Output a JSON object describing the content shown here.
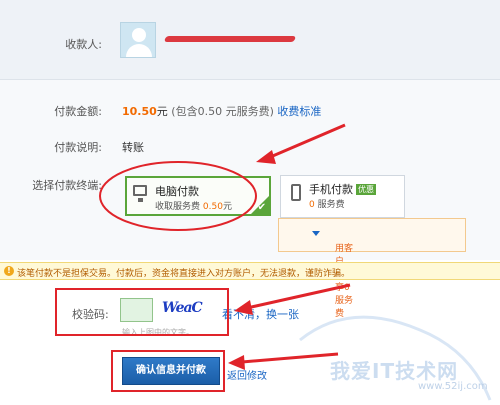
{
  "recipient": {
    "label": "收款人:"
  },
  "amount": {
    "label": "付款金额:",
    "value": "10.50",
    "unit": "元",
    "detail": "(包含0.50 元服务费)",
    "link": "收费标准"
  },
  "memo": {
    "label": "付款说明:",
    "value": "转账"
  },
  "terminal": {
    "label": "选择付款终端:",
    "pc": {
      "title": "电脑付款",
      "fee_prefix": "收取服务费",
      "fee": "0.50",
      "fee_unit": "元"
    },
    "mobile": {
      "title": "手机付款",
      "badge": "优惠",
      "fee": "0",
      "fee_suffix": "服务费"
    },
    "client_tip": "用客户端，享0服务费"
  },
  "warning": {
    "icon": "!",
    "text": "该笔付款不是担保交易。付款后，资金将直接进入对方账户，无法退款，谨防诈骗。"
  },
  "captcha": {
    "label": "校验码:",
    "image_text": "WeaC",
    "refresh": "看不清，换一张",
    "hint": "输入上图中的文字。"
  },
  "submit": {
    "label": "确认信息并付款"
  },
  "back": {
    "label": "返回修改"
  },
  "watermark": {
    "text": "我爱IT技术网",
    "url": "www.52ij.com"
  },
  "colors": {
    "accent": "#f26a00",
    "link": "#1a66c4",
    "annotation": "#e0242a",
    "selected": "#5aa53a"
  }
}
